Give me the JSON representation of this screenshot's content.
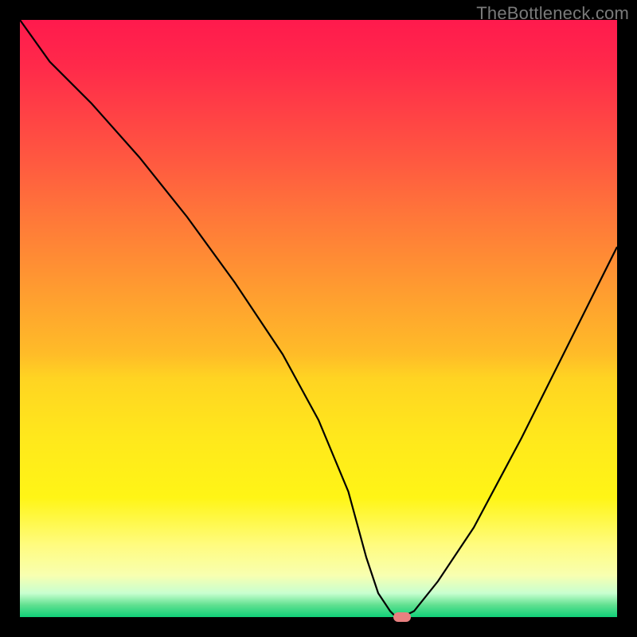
{
  "watermark": "TheBottleneck.com",
  "chart_data": {
    "type": "line",
    "title": "",
    "xlabel": "",
    "ylabel": "",
    "xlim": [
      0,
      100
    ],
    "ylim": [
      0,
      100
    ],
    "background_gradient": {
      "top": "#ff1a4d",
      "bottom": "#10d078",
      "meaning": "high (top) = bottleneck; low (bottom) = balanced"
    },
    "series": [
      {
        "name": "bottleneck-curve",
        "x": [
          0,
          5,
          12,
          20,
          28,
          36,
          44,
          50,
          55,
          58,
          60,
          62,
          63,
          64,
          66,
          70,
          76,
          84,
          92,
          100
        ],
        "values": [
          100,
          93,
          86,
          77,
          67,
          56,
          44,
          33,
          21,
          10,
          4,
          1,
          0,
          0,
          1,
          6,
          15,
          30,
          46,
          62
        ]
      }
    ],
    "marker": {
      "x": 64,
      "y": 0,
      "color": "#e88080"
    }
  }
}
